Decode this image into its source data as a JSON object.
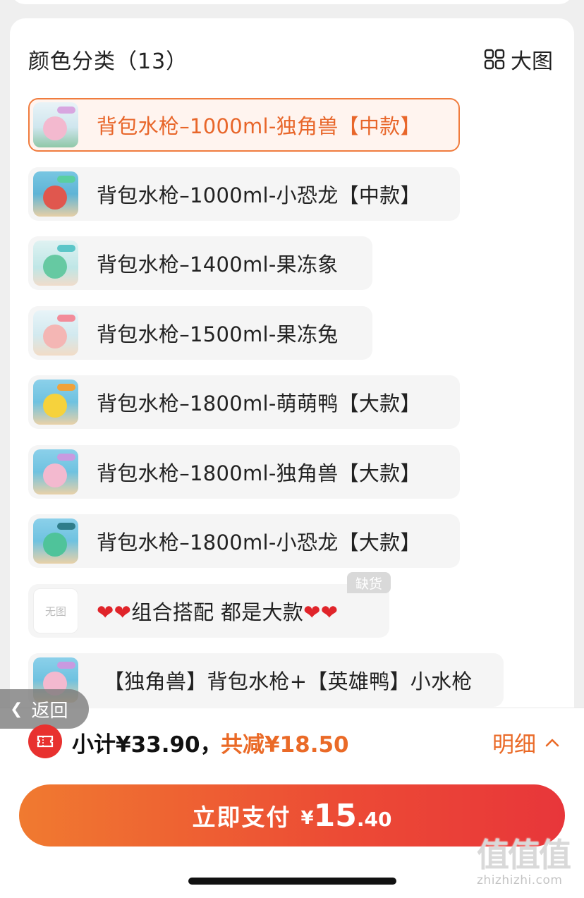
{
  "section": {
    "title": "颜色分类（13）",
    "big_picture_label": "大图"
  },
  "options": [
    {
      "label": "背包水枪–1000ml-独角兽【中款】",
      "selected": true
    },
    {
      "label": "背包水枪–1000ml-小恐龙【中款】",
      "selected": false
    },
    {
      "label": "背包水枪–1400ml-果冻象",
      "selected": false
    },
    {
      "label": "背包水枪–1500ml-果冻兔",
      "selected": false
    },
    {
      "label": "背包水枪–1800ml-萌萌鸭【大款】",
      "selected": false
    },
    {
      "label": "背包水枪–1800ml-独角兽【大款】",
      "selected": false
    },
    {
      "label": "背包水枪–1800ml-小恐龙【大款】",
      "selected": false
    },
    {
      "label": "组合搭配 都是大款",
      "selected": false,
      "no_image_text": "无图",
      "badge": "缺货"
    },
    {
      "label": "【独角兽】背包水枪+【英雄鸭】小水枪",
      "selected": false
    }
  ],
  "back_button": {
    "label": "返回"
  },
  "summary": {
    "subtotal": "小计¥33.90，",
    "discount": "共减¥18.50",
    "detail_label": "明细"
  },
  "pay_button": {
    "label": "立即支付",
    "currency": "¥",
    "amount_int": "15",
    "amount_dec": ".40"
  },
  "watermark": {
    "title": "值值值",
    "url": "zhizhizhi.com"
  },
  "colors": {
    "accent": "#ea6a27",
    "pay_gradient_start": "#f07a30",
    "pay_gradient_end": "#e8363a",
    "selected_border": "#f07c3e"
  }
}
